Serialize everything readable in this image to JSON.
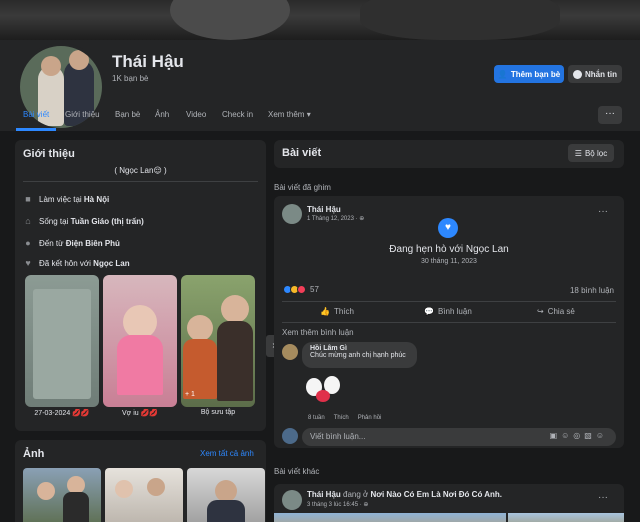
{
  "profile": {
    "name": "Thái Hậu",
    "friends": "1K bạn bè",
    "add_friend": "Thêm bạn bè",
    "message": "Nhắn tin"
  },
  "tabs": [
    "Bài viết",
    "Giới thiệu",
    "Bạn bè",
    "Ảnh",
    "Video",
    "Check in",
    "Xem thêm"
  ],
  "intro": {
    "title": "Giới thiệu",
    "bio": "( Ngọc Lan😌 )",
    "work_prefix": "Làm việc tại ",
    "work": "Hà Nội",
    "live_prefix": "Sống tại ",
    "live": "Tuần Giáo (thị trấn)",
    "from_prefix": "Đến từ ",
    "from": "Điện Biên Phủ",
    "married_prefix": "Đã kết hôn với ",
    "married": "Ngọc Lan",
    "stories": [
      {
        "label": "27-03-2024 💋💋",
        "tag": ""
      },
      {
        "label": "Vợ iu 💋💋",
        "tag": ""
      },
      {
        "label": "Bộ sưu tập",
        "tag": "+ 1"
      }
    ]
  },
  "photos": {
    "title": "Ảnh",
    "see_all": "Xem tất cả ảnh"
  },
  "posts_header": {
    "title": "Bài viết",
    "filter": "Bộ lọc",
    "pinned": "Bài viết đã ghim",
    "other": "Bài viết khác"
  },
  "post1": {
    "author": "Thái Hậu",
    "date": "1 Tháng 12, 2023 · ",
    "event": "Đang hẹn hò với Ngọc Lan",
    "event_date": "30 tháng 11, 2023",
    "reactions": "57",
    "comments_count": "18 bình luận",
    "like": "Thích",
    "comment": "Bình luận",
    "share": "Chia sẻ",
    "more_comments": "Xem thêm bình luận",
    "commenter": "Hồi Lâm Gì",
    "comment_text": "Chúc mừng anh chị hạnh phúc",
    "comment_time": "8 tuần",
    "comment_like": "Thích",
    "comment_reply": "Phản hồi",
    "input_placeholder": "Viết bình luận..."
  },
  "post2": {
    "author": "Thái Hậu",
    "middle": " đang ở ",
    "place": "Nơi Nào Có Em Là Nơi Đó Có Anh.",
    "date": "3 tháng 3 lúc 16:45 · "
  },
  "colors": {
    "accent": "#2d88ff",
    "card": "#242526",
    "background": "#18191a"
  }
}
